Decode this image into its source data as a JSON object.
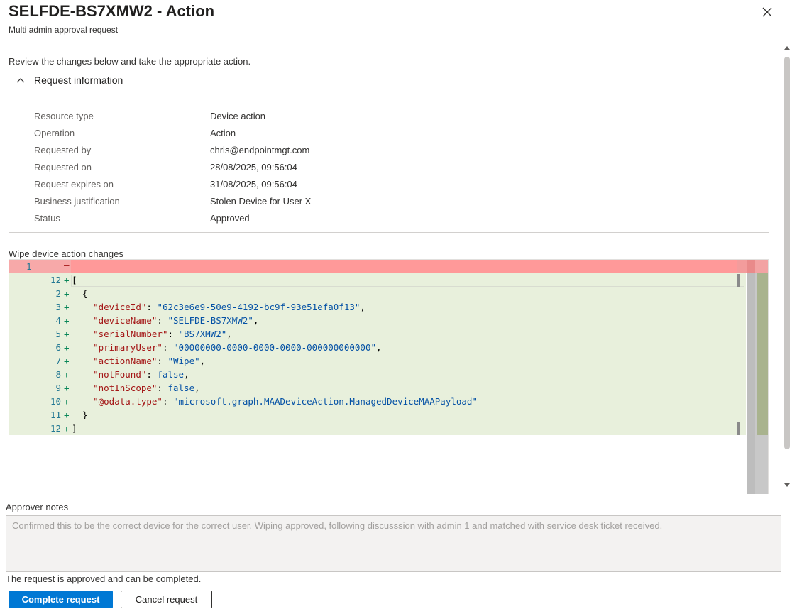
{
  "header": {
    "title": "SELFDE-BS7XMW2 - Action",
    "subtitle": "Multi admin approval request"
  },
  "intro": "Review the changes below and take the appropriate action.",
  "request_info": {
    "section_label": "Request information",
    "rows": [
      {
        "key": "Resource type",
        "value": "Device action"
      },
      {
        "key": "Operation",
        "value": "Action"
      },
      {
        "key": "Requested by",
        "value": "chris@endpointmgt.com"
      },
      {
        "key": "Requested on",
        "value": "28/08/2025, 09:56:04"
      },
      {
        "key": "Request expires on",
        "value": "31/08/2025, 09:56:04"
      },
      {
        "key": "Business justification",
        "value": "Stolen Device for User X"
      },
      {
        "key": "Status",
        "value": "Approved"
      }
    ]
  },
  "diff": {
    "label": "Wipe device action changes",
    "removed_line_number": "1",
    "removed_sign": "—",
    "added_lines": [
      {
        "n": "12",
        "text": "["
      },
      {
        "n": "2",
        "text": "  {"
      },
      {
        "n": "3",
        "key": "\"deviceId\"",
        "value": "\"62c3e6e9-50e9-4192-bc9f-93e51efa0f13\"",
        "suffix": ","
      },
      {
        "n": "4",
        "key": "\"deviceName\"",
        "value": "\"SELFDE-BS7XMW2\"",
        "suffix": ","
      },
      {
        "n": "5",
        "key": "\"serialNumber\"",
        "value": "\"BS7XMW2\"",
        "suffix": ","
      },
      {
        "n": "6",
        "key": "\"primaryUser\"",
        "value": "\"00000000-0000-0000-0000-000000000000\"",
        "suffix": ","
      },
      {
        "n": "7",
        "key": "\"actionName\"",
        "value": "\"Wipe\"",
        "suffix": ","
      },
      {
        "n": "8",
        "key": "\"notFound\"",
        "value": "false",
        "suffix": ","
      },
      {
        "n": "9",
        "key": "\"notInScope\"",
        "value": "false",
        "suffix": ","
      },
      {
        "n": "10",
        "key": "\"@odata.type\"",
        "value": "\"microsoft.graph.MAADeviceAction.ManagedDeviceMAAPayload\"",
        "suffix": ""
      },
      {
        "n": "11",
        "text": "  }"
      },
      {
        "n": "12",
        "text": "]"
      }
    ]
  },
  "approver_notes": {
    "label": "Approver notes",
    "value": "Confirmed this to be the correct device for the correct user. Wiping approved, following discusssion with admin 1 and matched with service desk ticket received."
  },
  "status_message": "The request is approved and can be completed.",
  "buttons": {
    "complete": "Complete request",
    "cancel": "Cancel request"
  },
  "colors": {
    "primary": "#0078d4",
    "removed_bg": "#f7a9a9",
    "added_bg": "#e8f0dc"
  }
}
